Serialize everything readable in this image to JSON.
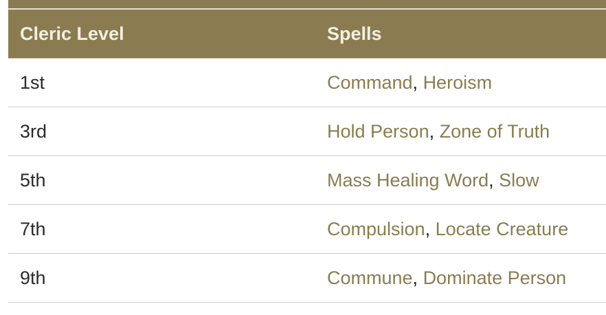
{
  "table": {
    "headers": {
      "level": "Cleric Level",
      "spells": "Spells"
    },
    "rows": [
      {
        "level": "1st",
        "spell_a": "Command",
        "separator": ", ",
        "spell_b": "Heroism"
      },
      {
        "level": "3rd",
        "spell_a": "Hold Person",
        "separator": ", ",
        "spell_b": "Zone of Truth"
      },
      {
        "level": "5th",
        "spell_a": "Mass Healing Word",
        "separator": ", ",
        "spell_b": "Slow"
      },
      {
        "level": "7th",
        "spell_a": "Compulsion",
        "separator": ", ",
        "spell_b": "Locate Creature"
      },
      {
        "level": "9th",
        "spell_a": "Commune",
        "separator": ", ",
        "spell_b": "Dominate Person"
      }
    ]
  },
  "colors": {
    "header_background": "#8a7c50",
    "header_text": "#f3efe3",
    "link": "#8a7c50",
    "row_divider": "#cfcfcf"
  }
}
